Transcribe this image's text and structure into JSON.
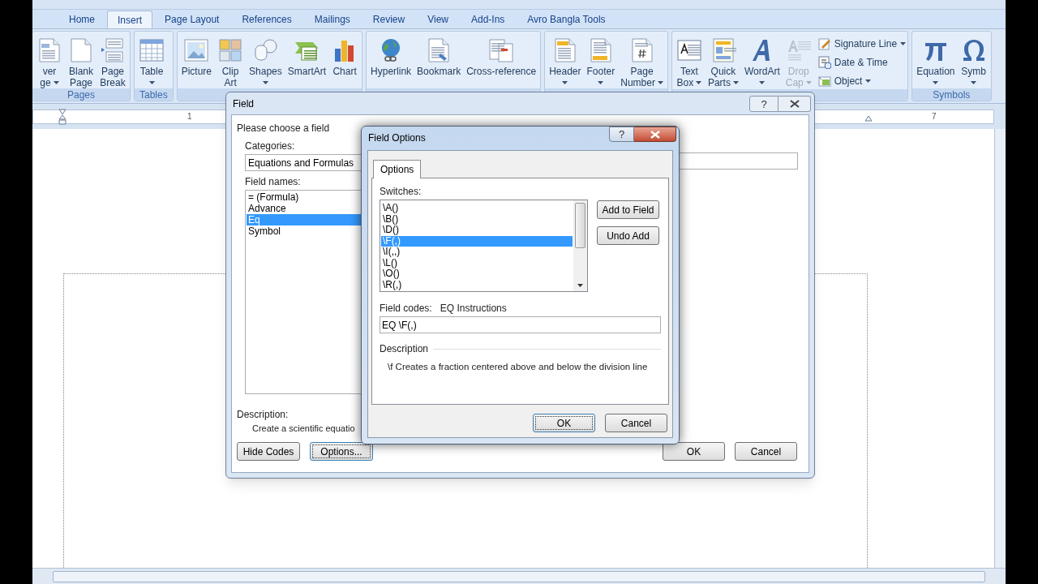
{
  "ribbon": {
    "tabs": [
      {
        "label": "Home",
        "selected": false
      },
      {
        "label": "Insert",
        "selected": true
      },
      {
        "label": "Page Layout",
        "selected": false
      },
      {
        "label": "References",
        "selected": false
      },
      {
        "label": "Mailings",
        "selected": false
      },
      {
        "label": "Review",
        "selected": false
      },
      {
        "label": "View",
        "selected": false
      },
      {
        "label": "Add-Ins",
        "selected": false
      },
      {
        "label": "Avro Bangla Tools",
        "selected": false
      }
    ],
    "groups": [
      {
        "label": "Pages",
        "buttons": [
          {
            "lines": [
              "ver",
              "ge"
            ],
            "menu": true,
            "disabled": false
          },
          {
            "lines": [
              "Blank",
              "Page"
            ],
            "menu": false,
            "disabled": false
          },
          {
            "lines": [
              "Page",
              "Break"
            ],
            "menu": false,
            "disabled": false
          }
        ]
      },
      {
        "label": "Tables",
        "buttons": [
          {
            "lines": [
              "Table"
            ],
            "menu": true,
            "disabled": false
          }
        ]
      },
      {
        "buttons": [
          {
            "lines": [
              "Picture"
            ],
            "menu": false,
            "disabled": false
          },
          {
            "lines": [
              "Clip",
              "Art"
            ],
            "menu": false,
            "disabled": false
          },
          {
            "lines": [
              "Shapes"
            ],
            "menu": true,
            "disabled": false
          },
          {
            "lines": [
              "SmartArt"
            ],
            "menu": false,
            "disabled": false
          },
          {
            "lines": [
              "Chart"
            ],
            "menu": false,
            "disabled": false
          }
        ]
      },
      {
        "buttons": [
          {
            "lines": [
              "Hyperlink"
            ],
            "menu": false,
            "disabled": false
          },
          {
            "lines": [
              "Bookmark"
            ],
            "menu": false,
            "disabled": false
          },
          {
            "lines": [
              "Cross-reference"
            ],
            "menu": false,
            "disabled": false
          }
        ]
      },
      {
        "buttons": [
          {
            "lines": [
              "Header"
            ],
            "menu": true,
            "disabled": false
          },
          {
            "lines": [
              "Footer"
            ],
            "menu": true,
            "disabled": false
          },
          {
            "lines": [
              "Page",
              "Number"
            ],
            "menu": true,
            "disabled": false
          }
        ]
      },
      {
        "buttons": [
          {
            "lines": [
              "Text",
              "Box"
            ],
            "menu": true,
            "disabled": false
          },
          {
            "lines": [
              "Quick",
              "Parts"
            ],
            "menu": true,
            "disabled": false
          },
          {
            "lines": [
              "WordArt"
            ],
            "menu": true,
            "disabled": false
          },
          {
            "lines": [
              "Drop",
              "Cap"
            ],
            "menu": true,
            "disabled": true
          }
        ],
        "small_buttons": [
          {
            "label": "Signature Line",
            "menu": true
          },
          {
            "label": "Date & Time",
            "menu": false
          },
          {
            "label": "Object",
            "menu": true
          }
        ]
      },
      {
        "label": "Symbols",
        "buttons": [
          {
            "lines": [
              "Equation"
            ],
            "menu": true,
            "disabled": false
          },
          {
            "lines": [
              "Symb"
            ],
            "menu": true,
            "disabled": false
          }
        ]
      }
    ]
  },
  "ruler": {
    "labels": [
      "1",
      "7"
    ]
  },
  "help_glyph": "?",
  "field_dialog": {
    "title": "Field",
    "section": "Please choose a field",
    "categories_label": "Categories:",
    "category": "Equations and Formulas",
    "field_names_label": "Field names:",
    "field_names": [
      {
        "label": "= (Formula)",
        "selected": false
      },
      {
        "label": "Advance",
        "selected": false
      },
      {
        "label": "Eq",
        "selected": true
      },
      {
        "label": "Symbol",
        "selected": false
      }
    ],
    "description_label": "Description:",
    "description": "Create a scientific equatio",
    "left_buttons": [
      {
        "label": "Hide Codes",
        "focused": false
      },
      {
        "label": "Options...",
        "focused": true
      }
    ],
    "right_buttons": [
      {
        "label": "OK",
        "focused": false
      },
      {
        "label": "Cancel",
        "focused": false
      }
    ]
  },
  "options_dialog": {
    "title": "Field Options",
    "tabs": [
      {
        "label": "Options",
        "selected": true
      }
    ],
    "switches_label": "Switches:",
    "switches": [
      {
        "label": "\\A()",
        "selected": false
      },
      {
        "label": "\\B()",
        "selected": false
      },
      {
        "label": "\\D()",
        "selected": false
      },
      {
        "label": "\\F(,)",
        "selected": true
      },
      {
        "label": "\\I(,,)",
        "selected": false
      },
      {
        "label": "\\L()",
        "selected": false
      },
      {
        "label": "\\O()",
        "selected": false
      },
      {
        "label": "\\R(,)",
        "selected": false
      }
    ],
    "side_buttons": [
      "Add to Field",
      "Undo Add"
    ],
    "field_codes_label": "Field codes:",
    "field_codes_hint": "EQ Instructions",
    "field_codes": "EQ \\F(,)",
    "description_label": "Description",
    "description": "\\f Creates a fraction centered above and below the division line",
    "footer_buttons": [
      {
        "label": "OK",
        "focused": true
      },
      {
        "label": "Cancel",
        "focused": false
      }
    ]
  }
}
